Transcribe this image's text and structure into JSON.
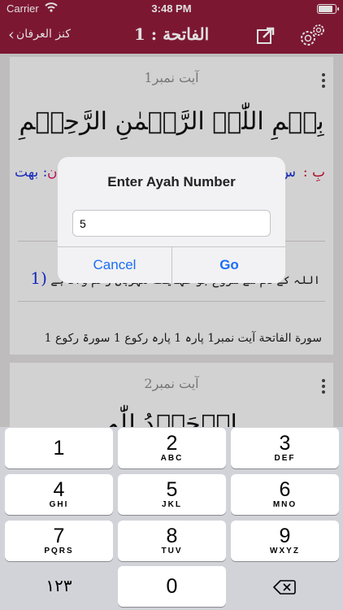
{
  "status_bar": {
    "carrier": "Carrier",
    "time": "3:48 PM",
    "battery_level": 0.9
  },
  "navbar": {
    "back_label": "کنز العرفان",
    "title": "الفاتحة : 1",
    "share_icon": "share-icon",
    "settings_icon": "gear-icon"
  },
  "cards": [
    {
      "ayah_label": "آیت نمبر1",
      "arabic": "بِسۡمِ اللّٰہِ الرَّحۡمٰنِ الرَّحِیۡمِ",
      "word_red": "بِ :",
      "word_blue": "س",
      "word_pink": "ن",
      "word_blue2": ": بهت",
      "translation": "اللہ کے نام سے شروع جو نہایت مہربان رحم والا ہے",
      "translation_num": "(1",
      "reference": "سورة الفاتحة آیت نمبر1  پارہ 1 پارہ رکوع 1  سورۃ رکوع 1"
    },
    {
      "ayah_label": "آیت نمبر2",
      "arabic": "الۡحَمۡدُ لِلّٰہِ"
    }
  ],
  "alert": {
    "title": "Enter Ayah Number",
    "input_value": "5",
    "cancel_label": "Cancel",
    "go_label": "Go"
  },
  "keyboard": {
    "keys": [
      {
        "digit": "1",
        "letters": ""
      },
      {
        "digit": "2",
        "letters": "ABC"
      },
      {
        "digit": "3",
        "letters": "DEF"
      },
      {
        "digit": "4",
        "letters": "GHI"
      },
      {
        "digit": "5",
        "letters": "JKL"
      },
      {
        "digit": "6",
        "letters": "MNO"
      },
      {
        "digit": "7",
        "letters": "PQRS"
      },
      {
        "digit": "8",
        "letters": "TUV"
      },
      {
        "digit": "9",
        "letters": "WXYZ"
      },
      {
        "digit": "0",
        "letters": ""
      }
    ],
    "switch_label": "۱۲۳",
    "delete_icon": "delete-icon"
  },
  "colors": {
    "brand": "#8e1b3a",
    "link": "#1a6ef5"
  }
}
